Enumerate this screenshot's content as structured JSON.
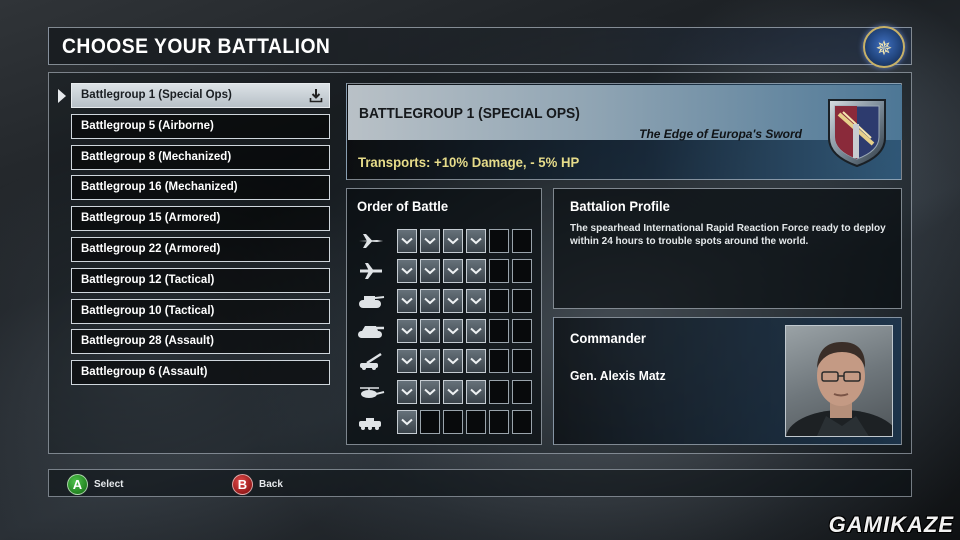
{
  "header": {
    "title": "CHOOSE YOUR BATTALION"
  },
  "battalions": [
    {
      "label": "Battlegroup 1 (Special Ops)",
      "selected": true
    },
    {
      "label": "Battlegroup 5 (Airborne)"
    },
    {
      "label": "Battlegroup 8 (Mechanized)"
    },
    {
      "label": "Battlegroup 16 (Mechanized)"
    },
    {
      "label": "Battlegroup 15 (Armored)"
    },
    {
      "label": "Battlegroup 22 (Armored)"
    },
    {
      "label": "Battlegroup 12 (Tactical)"
    },
    {
      "label": "Battlegroup 10 (Tactical)"
    },
    {
      "label": "Battlegroup 28 (Assault)"
    },
    {
      "label": "Battlegroup 6 (Assault)"
    }
  ],
  "detail": {
    "name": "BATTLEGROUP 1 (SPECIAL OPS)",
    "motto": "The Edge of Europa's Sword",
    "bonus": "Transports: +10% Damage, - 5% HP"
  },
  "order_of_battle": {
    "title": "Order of Battle",
    "rows": [
      {
        "unit_icon": "jet-icon",
        "filled": 4,
        "total": 6
      },
      {
        "unit_icon": "bomber-icon",
        "filled": 4,
        "total": 6
      },
      {
        "unit_icon": "tank-icon",
        "filled": 4,
        "total": 6
      },
      {
        "unit_icon": "heavy-tank-icon",
        "filled": 4,
        "total": 6
      },
      {
        "unit_icon": "artillery-icon",
        "filled": 4,
        "total": 6
      },
      {
        "unit_icon": "helicopter-icon",
        "filled": 4,
        "total": 6
      },
      {
        "unit_icon": "apc-icon",
        "filled": 1,
        "total": 6
      }
    ]
  },
  "profile": {
    "title": "Battalion Profile",
    "text": "The spearhead International Rapid Reaction Force ready to deploy within 24 hours to trouble spots around the world."
  },
  "commander": {
    "title": "Commander",
    "name": "Gen. Alexis Matz"
  },
  "controls": {
    "select_key": "A",
    "select_label": "Select",
    "back_key": "B",
    "back_label": "Back"
  },
  "watermark": "GAMIKAZE"
}
